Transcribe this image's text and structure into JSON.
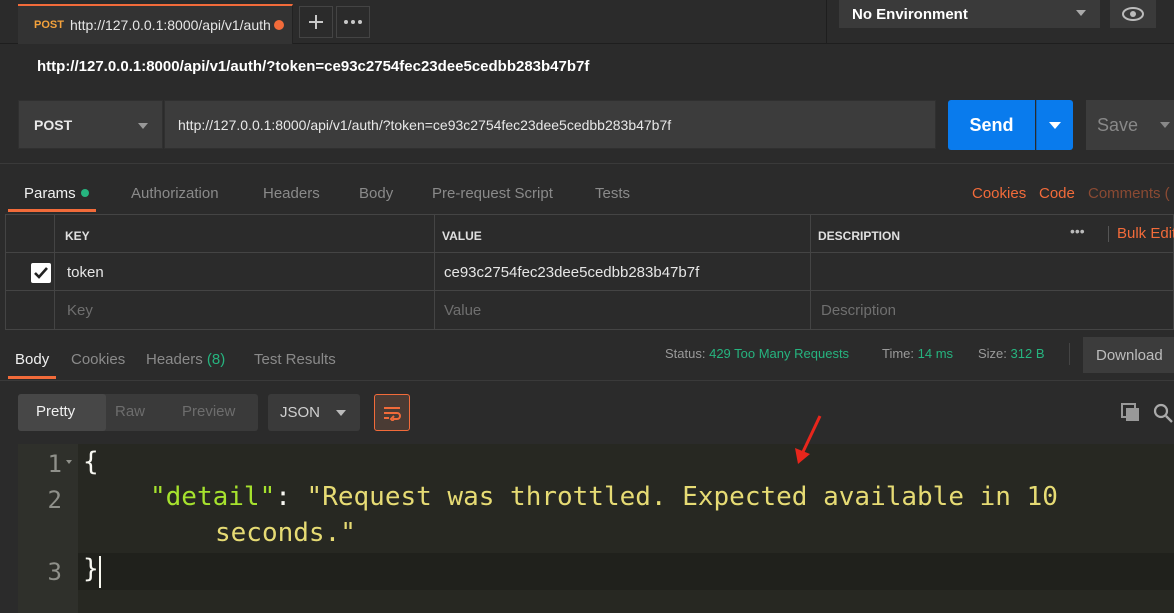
{
  "tab": {
    "method": "POST",
    "url": "http://127.0.0.1:8000/api/v1/auth"
  },
  "environment": {
    "selected": "No Environment"
  },
  "request": {
    "title": "http://127.0.0.1:8000/api/v1/auth/?token=ce93c2754fec23dee5cedbb283b47b7f",
    "method": "POST",
    "url": "http://127.0.0.1:8000/api/v1/auth/?token=ce93c2754fec23dee5cedbb283b47b7f",
    "send_label": "Send",
    "save_label": "Save"
  },
  "request_tabs": {
    "params": "Params",
    "authorization": "Authorization",
    "headers": "Headers",
    "body": "Body",
    "prerequest": "Pre-request Script",
    "tests": "Tests",
    "cookies": "Cookies",
    "code": "Code",
    "comments": "Comments ("
  },
  "params": {
    "columns": {
      "key": "KEY",
      "value": "VALUE",
      "description": "DESCRIPTION"
    },
    "more": "•••",
    "bulk_edit": "Bulk Edit",
    "rows": [
      {
        "checked": true,
        "key": "token",
        "value": "ce93c2754fec23dee5cedbb283b47b7f",
        "description": ""
      }
    ],
    "placeholder": {
      "key": "Key",
      "value": "Value",
      "description": "Description"
    }
  },
  "response_tabs": {
    "body": "Body",
    "cookies": "Cookies",
    "headers": "Headers",
    "headers_count": "(8)",
    "test_results": "Test Results"
  },
  "status": {
    "status_label": "Status:",
    "status_value": "429 Too Many Requests",
    "time_label": "Time:",
    "time_value": "14 ms",
    "size_label": "Size:",
    "size_value": "312 B",
    "download": "Download"
  },
  "view": {
    "pretty": "Pretty",
    "raw": "Raw",
    "preview": "Preview",
    "format": "JSON"
  },
  "code": {
    "line_numbers": [
      "1",
      "2",
      "3"
    ],
    "open_brace": "{",
    "key": "\"detail\"",
    "colon": ": ",
    "value_part1": "\"Request was throttled. Expected available in 10",
    "value_part2": "seconds.\"",
    "close_brace": "}"
  },
  "colors": {
    "accent": "#f26b3a",
    "send": "#097bed",
    "success": "#26b47f",
    "annotation_arrow": "#e8261c"
  }
}
